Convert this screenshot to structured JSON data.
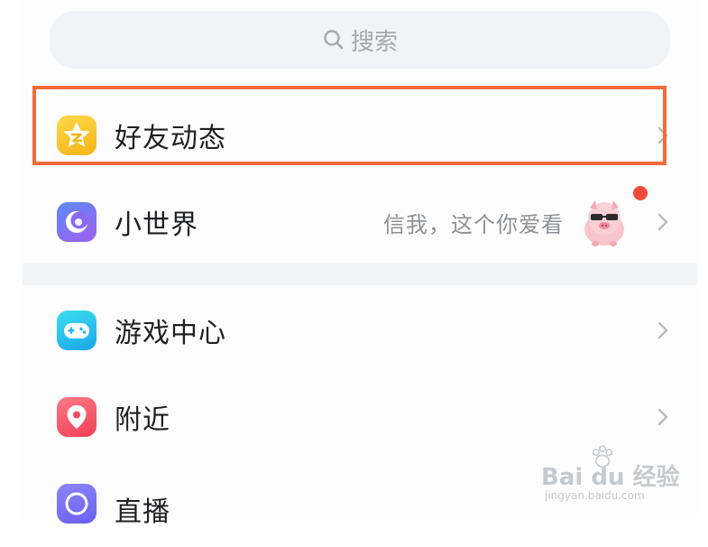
{
  "search": {
    "placeholder_label": "搜索"
  },
  "menu": {
    "items": [
      {
        "label": "好友动态",
        "icon": "star-icon",
        "icon_color": "#f7c52b"
      },
      {
        "label": "小世界",
        "icon": "crescent-icon",
        "icon_color": "#7b6ff2",
        "hint": "信我，这个你爱看",
        "has_badge": true
      },
      {
        "label": "游戏中心",
        "icon": "gamepad-icon",
        "icon_color": "#23c3ea"
      },
      {
        "label": "附近",
        "icon": "location-pin-icon",
        "icon_color": "#f35a68"
      },
      {
        "label": "直播",
        "icon": "live-icon",
        "icon_color": "#7b74f3"
      }
    ]
  },
  "highlight": {
    "color": "#f26b3a"
  },
  "watermark": {
    "brand": "Bai du 经验",
    "url": "jingyan.baidu.com"
  }
}
